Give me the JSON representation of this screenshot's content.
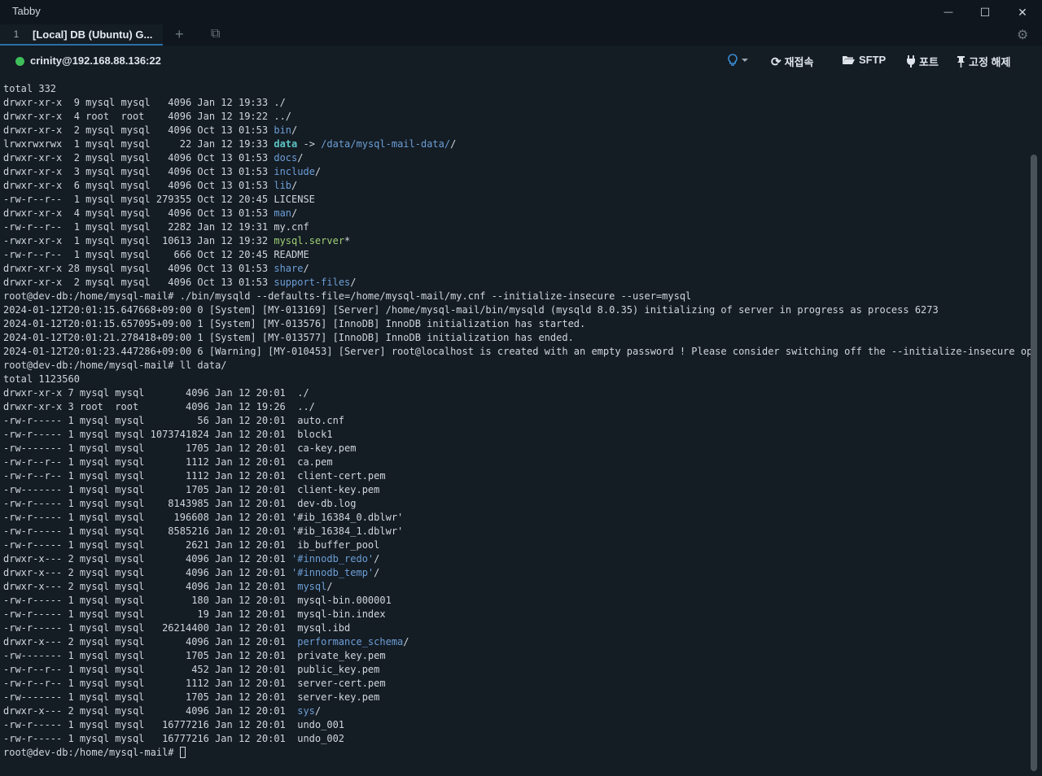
{
  "window": {
    "title": "Tabby",
    "minimize_glyph": "—",
    "maximize_glyph": "☐",
    "close_glyph": "✕"
  },
  "tabs": [
    {
      "index": "1",
      "label": "[Local] DB (Ubuntu) G..."
    }
  ],
  "tabbar": {
    "add_glyph": "+",
    "split_glyph": "⧉",
    "settings_glyph": "⚙"
  },
  "session": {
    "host": "crinity@192.168.88.136:22",
    "status_color": "#3fbf5a",
    "actions": [
      {
        "icon": "bulb-icon",
        "label": ""
      },
      {
        "icon": "refresh-icon",
        "label": "재접속"
      },
      {
        "icon": "folder-open-icon",
        "label": "SFTP"
      },
      {
        "icon": "plug-icon",
        "label": "포트"
      },
      {
        "icon": "pin-icon",
        "label": "고정 해제"
      }
    ]
  },
  "terminal": {
    "lines": [
      [
        {
          "t": "total 332"
        }
      ],
      [
        {
          "t": "drwxr-xr-x  9 mysql mysql   4096 Jan 12 19:33 "
        },
        {
          "t": "./"
        }
      ],
      [
        {
          "t": "drwxr-xr-x  4 root  root    4096 Jan 12 19:22 "
        },
        {
          "t": "../"
        }
      ],
      [
        {
          "t": "drwxr-xr-x  2 mysql mysql   4096 Oct 13 01:53 "
        },
        {
          "t": "bin",
          "c": "dir"
        },
        {
          "t": "/"
        }
      ],
      [
        {
          "t": "lrwxrwxrwx  1 mysql mysql     22 Jan 12 19:33 "
        },
        {
          "t": "data",
          "c": "link"
        },
        {
          "t": " -> "
        },
        {
          "t": "/data/mysql-mail-data/",
          "c": "dir"
        },
        {
          "t": "/"
        }
      ],
      [
        {
          "t": "drwxr-xr-x  2 mysql mysql   4096 Oct 13 01:53 "
        },
        {
          "t": "docs",
          "c": "dir"
        },
        {
          "t": "/"
        }
      ],
      [
        {
          "t": "drwxr-xr-x  3 mysql mysql   4096 Oct 13 01:53 "
        },
        {
          "t": "include",
          "c": "dir"
        },
        {
          "t": "/"
        }
      ],
      [
        {
          "t": "drwxr-xr-x  6 mysql mysql   4096 Oct 13 01:53 "
        },
        {
          "t": "lib",
          "c": "dir"
        },
        {
          "t": "/"
        }
      ],
      [
        {
          "t": "-rw-r--r--  1 mysql mysql 279355 Oct 12 20:45 LICENSE"
        }
      ],
      [
        {
          "t": "drwxr-xr-x  4 mysql mysql   4096 Oct 13 01:53 "
        },
        {
          "t": "man",
          "c": "dir"
        },
        {
          "t": "/"
        }
      ],
      [
        {
          "t": "-rw-r--r--  1 mysql mysql   2282 Jan 12 19:31 my.cnf"
        }
      ],
      [
        {
          "t": "-rwxr-xr-x  1 mysql mysql  10613 Jan 12 19:32 "
        },
        {
          "t": "mysql.server",
          "c": "exe"
        },
        {
          "t": "*"
        }
      ],
      [
        {
          "t": "-rw-r--r--  1 mysql mysql    666 Oct 12 20:45 README"
        }
      ],
      [
        {
          "t": "drwxr-xr-x 28 mysql mysql   4096 Oct 13 01:53 "
        },
        {
          "t": "share",
          "c": "dir"
        },
        {
          "t": "/"
        }
      ],
      [
        {
          "t": "drwxr-xr-x  2 mysql mysql   4096 Oct 13 01:53 "
        },
        {
          "t": "support-files",
          "c": "dir"
        },
        {
          "t": "/"
        }
      ],
      [
        {
          "t": "root@dev-db:/home/mysql-mail# ./bin/mysqld --defaults-file=/home/mysql-mail/my.cnf --initialize-insecure --user=mysql"
        }
      ],
      [
        {
          "t": "2024-01-12T20:01:15.647668+09:00 0 [System] [MY-013169] [Server] /home/mysql-mail/bin/mysqld (mysqld 8.0.35) initializing of server in progress as process 6273"
        }
      ],
      [
        {
          "t": "2024-01-12T20:01:15.657095+09:00 1 [System] [MY-013576] [InnoDB] InnoDB initialization has started."
        }
      ],
      [
        {
          "t": "2024-01-12T20:01:21.278418+09:00 1 [System] [MY-013577] [InnoDB] InnoDB initialization has ended."
        }
      ],
      [
        {
          "t": "2024-01-12T20:01:23.447286+09:00 6 [Warning] [MY-010453] [Server] root@localhost is created with an empty password ! Please consider switching off the --initialize-insecure option."
        }
      ],
      [
        {
          "t": "root@dev-db:/home/mysql-mail# ll data/"
        }
      ],
      [
        {
          "t": "total 1123560"
        }
      ],
      [
        {
          "t": "drwxr-xr-x 7 mysql mysql       4096 Jan 12 20:01  "
        },
        {
          "t": "./"
        }
      ],
      [
        {
          "t": "drwxr-xr-x 3 root  root        4096 Jan 12 19:26  "
        },
        {
          "t": "../"
        }
      ],
      [
        {
          "t": "-rw-r----- 1 mysql mysql         56 Jan 12 20:01  auto.cnf"
        }
      ],
      [
        {
          "t": "-rw-r----- 1 mysql mysql 1073741824 Jan 12 20:01  block1"
        }
      ],
      [
        {
          "t": "-rw------- 1 mysql mysql       1705 Jan 12 20:01  ca-key.pem"
        }
      ],
      [
        {
          "t": "-rw-r--r-- 1 mysql mysql       1112 Jan 12 20:01  ca.pem"
        }
      ],
      [
        {
          "t": "-rw-r--r-- 1 mysql mysql       1112 Jan 12 20:01  client-cert.pem"
        }
      ],
      [
        {
          "t": "-rw------- 1 mysql mysql       1705 Jan 12 20:01  client-key.pem"
        }
      ],
      [
        {
          "t": "-rw-r----- 1 mysql mysql    8143985 Jan 12 20:01  dev-db.log"
        }
      ],
      [
        {
          "t": "-rw-r----- 1 mysql mysql     196608 Jan 12 20:01 '#ib_16384_0.dblwr'"
        }
      ],
      [
        {
          "t": "-rw-r----- 1 mysql mysql    8585216 Jan 12 20:01 '#ib_16384_1.dblwr'"
        }
      ],
      [
        {
          "t": "-rw-r----- 1 mysql mysql       2621 Jan 12 20:01  ib_buffer_pool"
        }
      ],
      [
        {
          "t": "drwxr-x--- 2 mysql mysql       4096 Jan 12 20:01 "
        },
        {
          "t": "'#innodb_redo'",
          "c": "dir"
        },
        {
          "t": "/"
        }
      ],
      [
        {
          "t": "drwxr-x--- 2 mysql mysql       4096 Jan 12 20:01 "
        },
        {
          "t": "'#innodb_temp'",
          "c": "dir"
        },
        {
          "t": "/"
        }
      ],
      [
        {
          "t": "drwxr-x--- 2 mysql mysql       4096 Jan 12 20:01  "
        },
        {
          "t": "mysql",
          "c": "dir"
        },
        {
          "t": "/"
        }
      ],
      [
        {
          "t": "-rw-r----- 1 mysql mysql        180 Jan 12 20:01  mysql-bin.000001"
        }
      ],
      [
        {
          "t": "-rw-r----- 1 mysql mysql         19 Jan 12 20:01  mysql-bin.index"
        }
      ],
      [
        {
          "t": "-rw-r----- 1 mysql mysql   26214400 Jan 12 20:01  mysql.ibd"
        }
      ],
      [
        {
          "t": "drwxr-x--- 2 mysql mysql       4096 Jan 12 20:01  "
        },
        {
          "t": "performance_schema",
          "c": "dir"
        },
        {
          "t": "/"
        }
      ],
      [
        {
          "t": "-rw------- 1 mysql mysql       1705 Jan 12 20:01  private_key.pem"
        }
      ],
      [
        {
          "t": "-rw-r--r-- 1 mysql mysql        452 Jan 12 20:01  public_key.pem"
        }
      ],
      [
        {
          "t": "-rw-r--r-- 1 mysql mysql       1112 Jan 12 20:01  server-cert.pem"
        }
      ],
      [
        {
          "t": "-rw------- 1 mysql mysql       1705 Jan 12 20:01  server-key.pem"
        }
      ],
      [
        {
          "t": "drwxr-x--- 2 mysql mysql       4096 Jan 12 20:01  "
        },
        {
          "t": "sys",
          "c": "dir"
        },
        {
          "t": "/"
        }
      ],
      [
        {
          "t": "-rw-r----- 1 mysql mysql   16777216 Jan 12 20:01  undo_001"
        }
      ],
      [
        {
          "t": "-rw-r----- 1 mysql mysql   16777216 Jan 12 20:01  undo_002"
        }
      ],
      [
        {
          "t": "root@dev-db:/home/mysql-mail# "
        }
      ]
    ]
  }
}
